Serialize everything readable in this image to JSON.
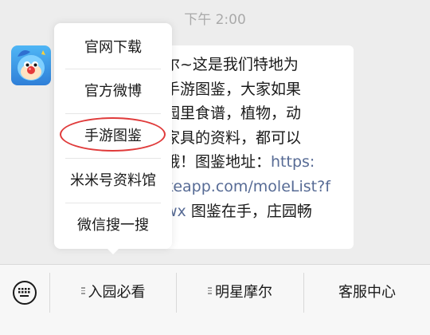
{
  "chat": {
    "timestamp": "下午 2:00",
    "message_lines": [
      "尔~这是我们特地为",
      "手游图鉴，大家如果",
      "园里食谱，植物，动",
      "家具的资料，都可以",
      "哦！图鉴地址：",
      "keapp.com/moleList?f",
      "wx 图鉴在手，庄园畅"
    ],
    "link_start": "https:",
    "link_middle": "keapp.com/moleList?f",
    "link_end": "wx",
    "line5_prefix": "哦！图鉴地址：",
    "line7_suffix": " 图鉴在手，庄园畅"
  },
  "popup_menu": {
    "items": [
      {
        "label": "官网下载"
      },
      {
        "label": "官方微博"
      },
      {
        "label": "手游图鉴"
      },
      {
        "label": "米米号资料馆"
      },
      {
        "label": "微信搜一搜"
      }
    ],
    "highlight_color": "#e03b3b"
  },
  "bottom_menu": {
    "keyboard_icon": "keyboard-icon",
    "items": [
      {
        "label": "入园必看",
        "has_submenu": true
      },
      {
        "label": "明星摩尔",
        "has_submenu": true
      },
      {
        "label": "客服中心",
        "has_submenu": false
      }
    ]
  },
  "colors": {
    "background": "#ededed",
    "link": "#576b95",
    "bubble": "#ffffff"
  }
}
